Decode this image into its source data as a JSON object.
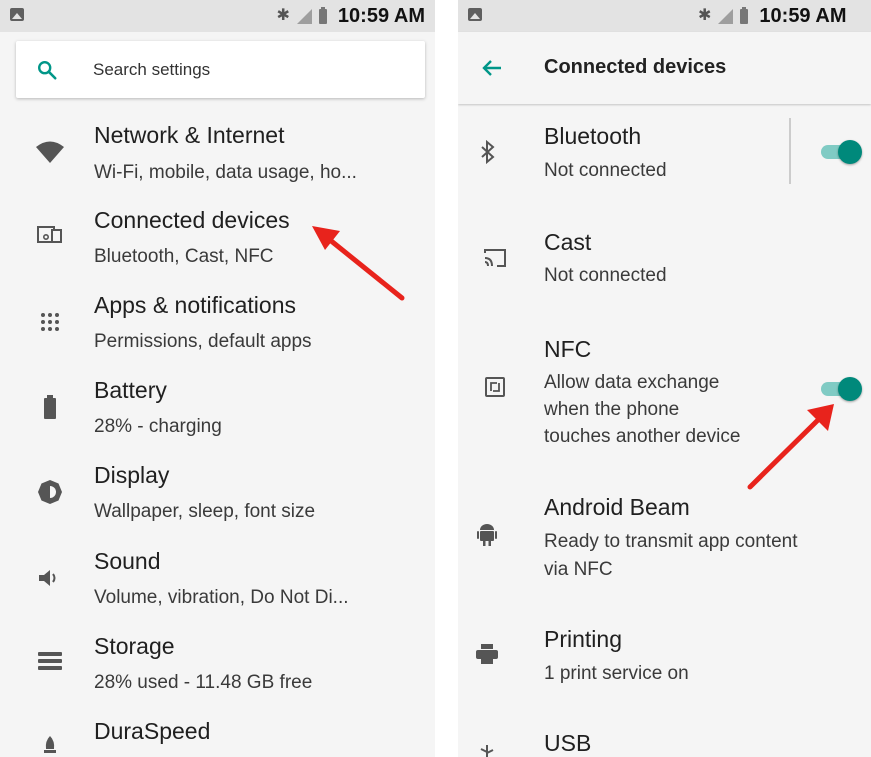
{
  "left": {
    "status_time": "10:59 AM",
    "search_placeholder": "Search settings",
    "items": [
      {
        "title": "Network & Internet",
        "subtitle": "Wi-Fi, mobile, data usage, ho...",
        "icon": "wifi-icon"
      },
      {
        "title": "Connected devices",
        "subtitle": "Bluetooth, Cast, NFC",
        "icon": "devices-icon"
      },
      {
        "title": "Apps & notifications",
        "subtitle": "Permissions, default apps",
        "icon": "apps-grid-icon"
      },
      {
        "title": "Battery",
        "subtitle": "28% - charging",
        "icon": "battery-icon"
      },
      {
        "title": "Display",
        "subtitle": "Wallpaper, sleep, font size",
        "icon": "brightness-icon"
      },
      {
        "title": "Sound",
        "subtitle": "Volume, vibration, Do Not Di...",
        "icon": "volume-icon"
      },
      {
        "title": "Storage",
        "subtitle": "28% used - 11.48 GB free",
        "icon": "storage-icon"
      },
      {
        "title": "DuraSpeed",
        "subtitle": "",
        "icon": "rocket-icon"
      }
    ]
  },
  "right": {
    "status_time": "10:59 AM",
    "title": "Connected devices",
    "items": [
      {
        "title": "Bluetooth",
        "lines": [
          "Not connected"
        ],
        "icon": "bluetooth-icon",
        "toggle": "on"
      },
      {
        "title": "Cast",
        "lines": [
          "Not connected"
        ],
        "icon": "cast-icon"
      },
      {
        "title": "NFC",
        "lines": [
          "Allow data exchange",
          "when the phone",
          "touches another device"
        ],
        "icon": "nfc-icon",
        "toggle": "on"
      },
      {
        "title": "Android Beam",
        "lines": [
          "Ready to transmit app content",
          "via NFC"
        ],
        "icon": "android-icon"
      },
      {
        "title": "Printing",
        "lines": [
          "1 print service on"
        ],
        "icon": "printer-icon"
      },
      {
        "title": "USB",
        "lines": [],
        "icon": "usb-icon"
      }
    ]
  },
  "colors": {
    "accent": "#009688",
    "toggle_thumb": "#00897b",
    "toggle_track": "#80cbc4",
    "annotation_arrow": "#e8231c",
    "background": "#f5f5f5",
    "status_bar": "#e3e3e3"
  }
}
